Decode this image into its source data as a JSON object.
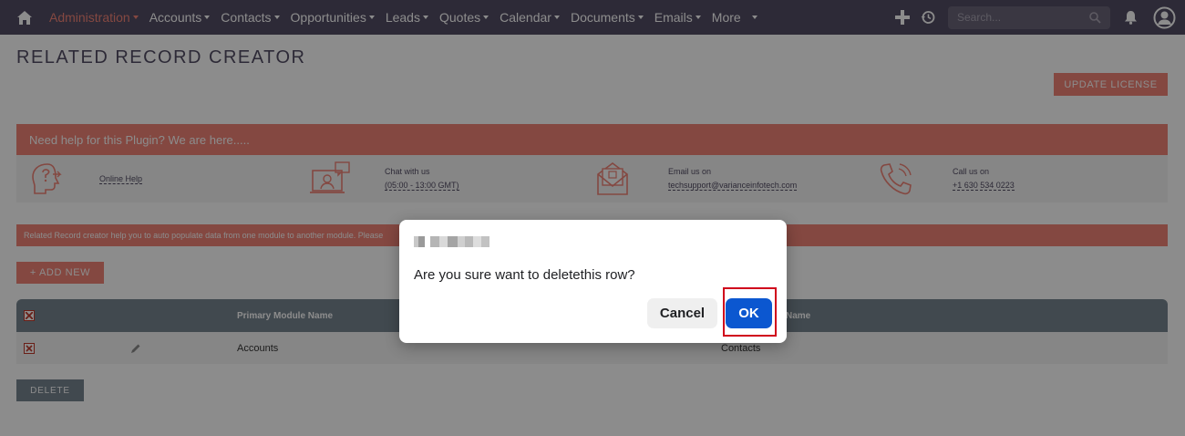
{
  "nav": {
    "home_icon": "home-icon",
    "items": [
      {
        "label": "Administration",
        "active": true
      },
      {
        "label": "Accounts"
      },
      {
        "label": "Contacts"
      },
      {
        "label": "Opportunities"
      },
      {
        "label": "Leads"
      },
      {
        "label": "Quotes"
      },
      {
        "label": "Calendar"
      },
      {
        "label": "Documents"
      },
      {
        "label": "Emails"
      },
      {
        "label": "More"
      }
    ],
    "search_placeholder": "Search...",
    "icons": [
      "plus-icon",
      "history-icon",
      "search-icon",
      "bell-icon",
      "user-avatar-icon"
    ]
  },
  "page": {
    "title": "RELATED RECORD CREATOR",
    "update_license_label": "UPDATE LICENSE"
  },
  "help": {
    "banner": "Need help for this Plugin? We are here.....",
    "online_help": "Online Help",
    "chat_line1": "Chat with us",
    "chat_line2": "(05:00 - 13:00 GMT)",
    "email_line1": "Email us on",
    "email_line2": "techsupport@varianceinfotech.com",
    "call_line1": "Call us on",
    "call_line2": "+1 630 534 0223"
  },
  "info": {
    "text": "Related Record creator help you to auto populate data from one module to another module. Please"
  },
  "actions": {
    "add_new": "+ ADD NEW",
    "delete": "DELETE"
  },
  "table": {
    "headers": {
      "primary": "Primary Module Name",
      "related": "Name"
    },
    "rows": [
      {
        "primary": "Accounts",
        "related": "Contacts"
      }
    ]
  },
  "dialog": {
    "message": "Are you sure want to deletethis row?",
    "cancel_label": "Cancel",
    "ok_label": "OK"
  },
  "colors": {
    "nav_bg": "#534d64",
    "accent": "#f08377",
    "table_header": "#778591",
    "ok_button": "#0b57d0",
    "highlight": "#d0021b"
  }
}
